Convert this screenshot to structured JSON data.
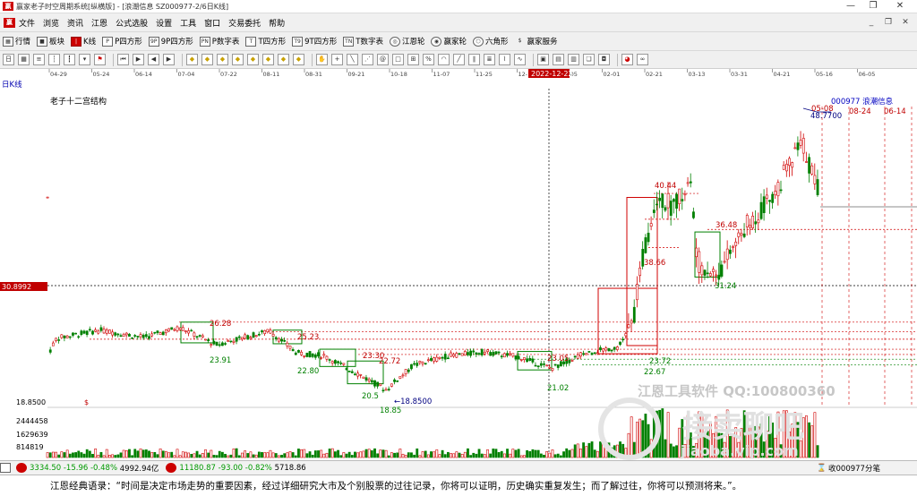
{
  "window": {
    "title": "赢家老子时空周期系统[纵横版] - [浪潮信息  SZ000977-2/6日K线]",
    "controls": [
      "—",
      "❐",
      "✕"
    ]
  },
  "menubar": {
    "items": [
      "文件",
      "浏览",
      "资讯",
      "江恩",
      "公式选股",
      "设置",
      "工具",
      "窗口",
      "交易委托",
      "帮助"
    ],
    "mdi_controls": [
      "_",
      "❐",
      "✕"
    ]
  },
  "toolbar1": {
    "items": [
      {
        "label": "行情",
        "icon": "grid-icon"
      },
      {
        "label": "板块",
        "icon": "blocks-icon"
      },
      {
        "label": "K线",
        "icon": "candle-icon"
      },
      {
        "label": "P四方形",
        "icon": "p-square-icon"
      },
      {
        "label": "9P四方形",
        "icon": "9p-square-icon"
      },
      {
        "label": "P数字表",
        "icon": "p-table-icon"
      },
      {
        "label": "T四方形",
        "icon": "t-square-icon"
      },
      {
        "label": "9T四方形",
        "icon": "9t-square-icon"
      },
      {
        "label": "T数字表",
        "icon": "t-table-icon"
      },
      {
        "label": "江恩轮",
        "icon": "wheel-icon"
      },
      {
        "label": "赢家轮",
        "icon": "wheel2-icon"
      },
      {
        "label": "六角形",
        "icon": "hexagon-icon"
      },
      {
        "label": "赢家服务",
        "icon": "service-icon"
      }
    ]
  },
  "toolbar2": {
    "icons": [
      "period-menu-icon",
      "grid-icon",
      "list-icon",
      "bars-icon",
      "candles-icon",
      "down-arrow-icon",
      "flag-icon",
      "first-icon",
      "play-icon",
      "prev-icon",
      "next-icon",
      "diamond-icon",
      "diamond-icon",
      "diamond-icon",
      "diamond-icon",
      "diamond-icon",
      "diamond-icon",
      "diamond-icon",
      "diamond-icon",
      "hand-icon",
      "cross-icon",
      "ray-icon",
      "fan-icon",
      "spiral-icon",
      "box-icon",
      "gann-icon",
      "percent-icon",
      "arc-icon",
      "trend-icon",
      "channel-icon",
      "fib-icon",
      "cycle-icon",
      "wave-icon",
      "calc-icon",
      "save-icon",
      "print-icon",
      "copy-icon",
      "camera-icon",
      "palette-icon",
      "infinity-icon"
    ]
  },
  "dates": {
    "ticks": [
      "04-29",
      "05-24",
      "06-14",
      "07-04",
      "07-22",
      "08-11",
      "08-31",
      "09-21",
      "10-18",
      "11-07",
      "11-25",
      "12-14",
      "01-05",
      "02-01",
      "02-21",
      "03-13",
      "03-31",
      "04-21",
      "05-16",
      "06-05"
    ],
    "cursor_date": "2022-12-22"
  },
  "chart": {
    "period_label": "日K线",
    "indicator_name": "老子十二宫结构",
    "stock_label": "000977  浪潮信息",
    "price_axis_label": "30.8992",
    "low_price_label": "18.8500",
    "volume_labels": [
      "2444458",
      "1629639",
      "814819"
    ],
    "line_labels": [
      {
        "text": "26.28",
        "color": "#c00000"
      },
      {
        "text": "23.91",
        "color": "#008000"
      },
      {
        "text": "25.23",
        "color": "#c00000"
      },
      {
        "text": "22.80",
        "color": "#008000"
      },
      {
        "text": "23.30",
        "color": "#c00000"
      },
      {
        "text": "22.72",
        "color": "#c00000"
      },
      {
        "text": "20.5",
        "color": "#008000"
      },
      {
        "text": "18.85",
        "color": "#008000"
      },
      {
        "text": "←18.8500",
        "color": "#000080"
      },
      {
        "text": "23.05",
        "color": "#c00000"
      },
      {
        "text": "21.02",
        "color": "#008000"
      },
      {
        "text": "23.72",
        "color": "#008000"
      },
      {
        "text": "22.67",
        "color": "#008000"
      },
      {
        "text": "40.44",
        "color": "#c00000"
      },
      {
        "text": "38.66",
        "color": "#c00000"
      },
      {
        "text": "36.48",
        "color": "#c00000"
      },
      {
        "text": "31.24",
        "color": "#008000"
      },
      {
        "text": "48.7700",
        "color": "#000080"
      },
      {
        "text": "05-08",
        "color": "#c00000"
      },
      {
        "text": "08-24",
        "color": "#c00000"
      },
      {
        "text": "06-14",
        "color": "#c00000"
      }
    ],
    "small_mark": "$"
  },
  "watermark": {
    "line1": "江恩工具软件  QQ:100800360",
    "line2": "接卖聊吧",
    "line3": "jiaoba.vip.com"
  },
  "statusbar": {
    "sh_index": "3334.50",
    "sh_change": "-15.96",
    "sh_pct": "-0.48%",
    "sh_amount": "4992.94亿",
    "sz_index": "11180.87",
    "sz_change": "-93.00",
    "sz_pct": "-0.82%",
    "sz_amount": "5718.86",
    "right_text": "收000977分笔"
  },
  "quote": "江恩经典语录：“时间是决定市场走势的重要因素，经过详细研究大市及个别股票的过往记录，你将可以证明，历史确实重复发生；而了解过往，你将可以预测将来。”。",
  "colors": {
    "up": "#d00000",
    "down": "#008000",
    "box_red": "#d00000",
    "box_green": "#008000"
  }
}
